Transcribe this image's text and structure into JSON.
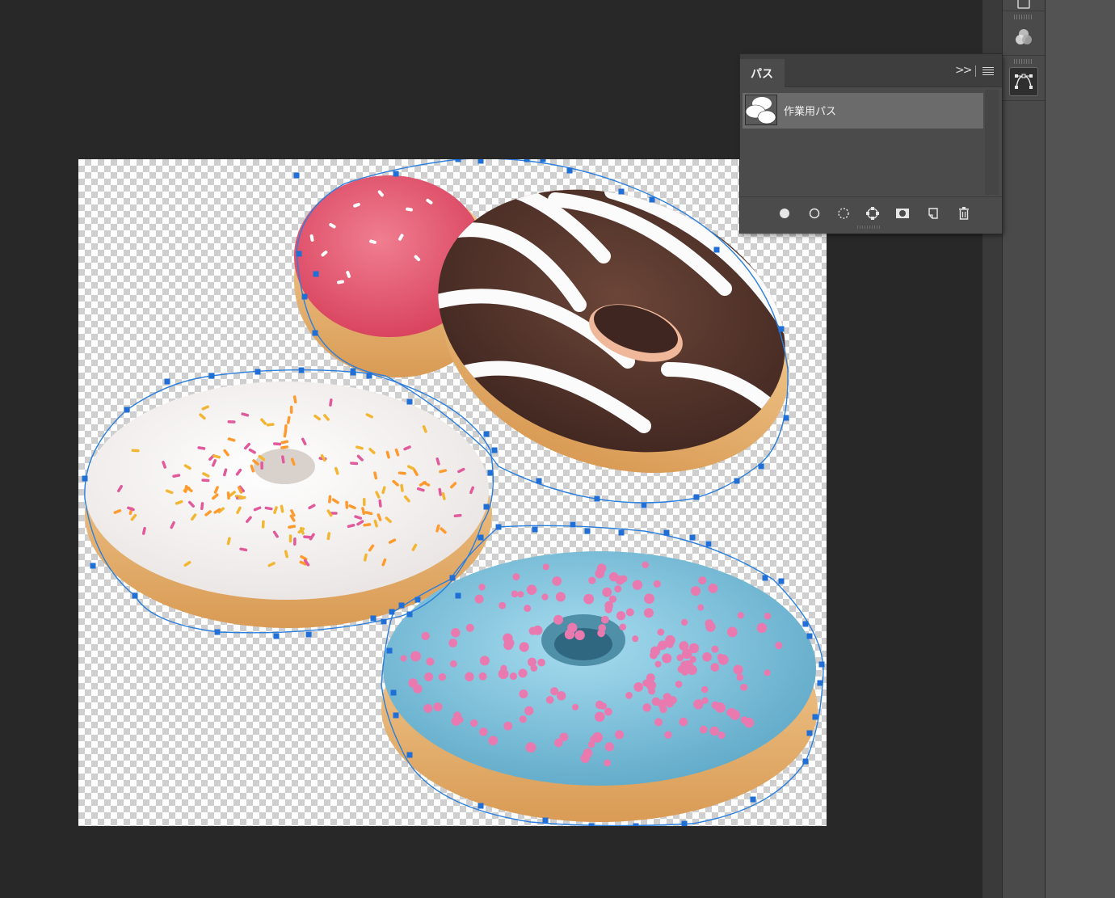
{
  "workspace": {
    "background": "#282828"
  },
  "canvas": {
    "transparency": "checkerboard",
    "donuts": [
      {
        "name": "pink-glazed-donut",
        "glaze": "#e4566d",
        "sprinkles": "#ffffff"
      },
      {
        "name": "chocolate-striped-donut",
        "glaze": "#5a3a30",
        "stripes": "#ffffff"
      },
      {
        "name": "white-sprinkle-donut",
        "glaze": "#f7f4f2",
        "sprinkles": [
          "#f2b632",
          "#e05a9c",
          "#ff9a2e"
        ]
      },
      {
        "name": "blue-pearl-donut",
        "glaze": "#7fbfd8",
        "pearls": "#e87ab0"
      }
    ],
    "work_path": {
      "stroke": "#2a7fde",
      "anchor_color": "#1f6fd6"
    }
  },
  "paths_panel": {
    "tab_label": "パス",
    "collapse_icon": "double-chevron-right-icon",
    "menu_icon": "hamburger-menu-icon",
    "items": [
      {
        "name": "作業用パス",
        "thumbnail": "work-path-thumbnail",
        "selected": true
      }
    ],
    "footer_buttons": [
      {
        "icon": "fill-path-icon"
      },
      {
        "icon": "stroke-path-icon"
      },
      {
        "icon": "load-as-selection-icon"
      },
      {
        "icon": "make-path-from-selection-icon"
      },
      {
        "icon": "add-mask-icon"
      },
      {
        "icon": "new-path-icon"
      },
      {
        "icon": "delete-path-icon"
      }
    ]
  },
  "dock": {
    "icons": [
      {
        "icon": "panel-top-icon"
      },
      {
        "icon": "channels-icon"
      },
      {
        "icon": "paths-icon",
        "active": true
      }
    ]
  }
}
